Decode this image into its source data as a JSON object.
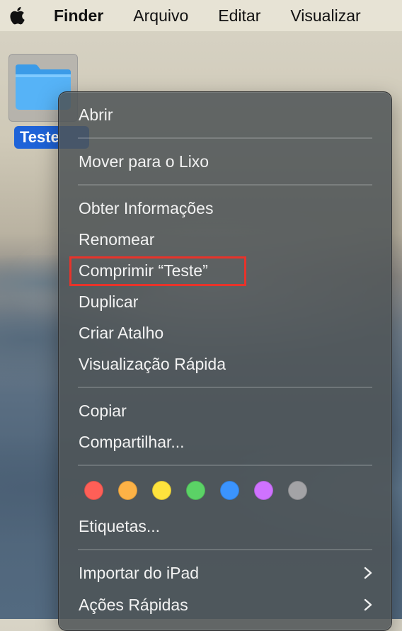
{
  "menubar": {
    "app": "Finder",
    "items": [
      "Arquivo",
      "Editar",
      "Visualizar"
    ]
  },
  "desktop": {
    "folder_label": "Teste"
  },
  "context_menu": {
    "open": "Abrir",
    "move_to_trash": "Mover para o Lixo",
    "get_info": "Obter Informações",
    "rename": "Renomear",
    "compress": "Comprimir “Teste”",
    "duplicate": "Duplicar",
    "make_alias": "Criar Atalho",
    "quick_look": "Visualização Rápida",
    "copy": "Copiar",
    "share": "Compartilhar...",
    "tags": "Etiquetas...",
    "import_from_ipad": "Importar do iPad",
    "quick_actions": "Ações Rápidas"
  },
  "tag_colors": [
    "#fe5f57",
    "#fdb246",
    "#fee33d",
    "#5bd266",
    "#3b94fe",
    "#cf72ff",
    "#a3a3a6"
  ],
  "highlight_color": "#e8332a"
}
